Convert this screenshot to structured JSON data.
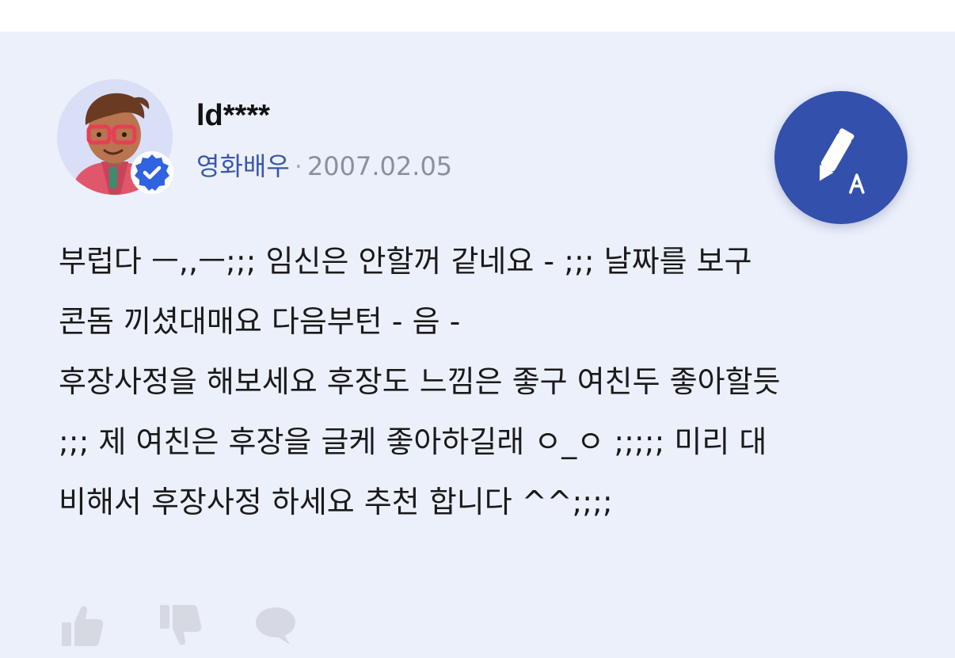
{
  "answer": {
    "author": {
      "username": "ld****",
      "role": "영화배우",
      "separator": "·",
      "date": "2007.02.05",
      "avatar": "3d-character-avatar",
      "verified_icon": "verified-badge-icon"
    },
    "body_lines": [
      "부럽다 ㅡ,,ㅡ;;;   임신은 안할꺼 같네요 - ;;;  날짜를 보구",
      "콘돔 끼셨대매요 다음부턴 - 음 -",
      "후장사정을 해보세요 후장도 느낌은 좋구 여친두 좋아할듯",
      ";;; 제 여친은 후장을 글케 좋아하길래 ㅇ_ㅇ ;;;;;   미리 대",
      "비해서 후장사정 하세요 추천 합니다 ^^;;;;"
    ],
    "actions": [
      {
        "name": "like-button",
        "icon": "thumbs-up-icon"
      },
      {
        "name": "dislike-button",
        "icon": "thumbs-down-icon"
      },
      {
        "name": "comment-button",
        "icon": "speech-bubble-icon"
      }
    ]
  },
  "fab": {
    "icon": "pencil-a-icon",
    "action": "write"
  },
  "colors": {
    "card_background": "#ecf0fb",
    "accent": "#3450ad",
    "role_text": "#3a57a6",
    "date_text": "#8a909d",
    "action_icon": "#d6d9e2"
  }
}
